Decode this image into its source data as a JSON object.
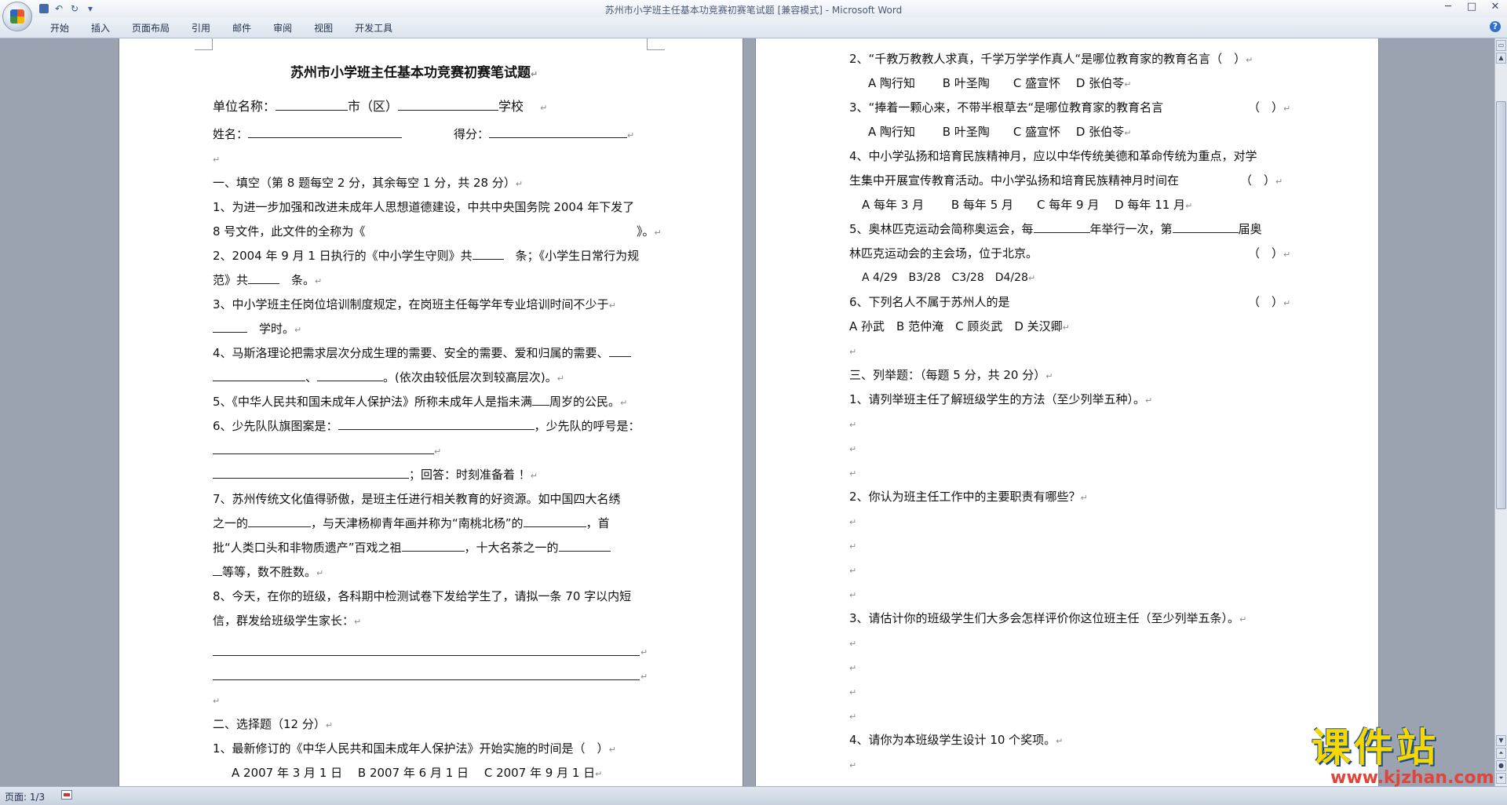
{
  "window": {
    "title": "苏州市小学班主任基本功竞赛初赛笔试题 [兼容模式] - Microsoft Word",
    "controls": [
      "─",
      "□",
      "✕"
    ]
  },
  "quick_access": {
    "undo": "↶",
    "redo": "↻",
    "more": "▾"
  },
  "ribbon": {
    "tabs": [
      "开始",
      "插入",
      "页面布局",
      "引用",
      "邮件",
      "审阅",
      "视图",
      "开发工具"
    ],
    "help": "?"
  },
  "status": {
    "page": "页面: 1/3"
  },
  "watermark": {
    "title": "课件站",
    "url": "www.kjzhan.com"
  },
  "left_page": {
    "title": "苏州市小学班主任基本功竞赛初赛笔试题",
    "unit_label": "单位名称：",
    "unit_city": "市（区）",
    "unit_school": "学校",
    "name_label": "姓名：",
    "score_label": "得分：",
    "sec1": "一、填空（第 8 题每空 2 分，其余每空 1 分，共 28 分）",
    "q1a": "1、为进一步加强和改进未成年人思想道德建设，中共中央国务院 2004 年下发了",
    "q1b": "8 号文件，此文件的全称为《",
    "q1c": "》。",
    "q2a": "2、2004 年 9 月 1 日执行的《中小学生守则》共",
    "q2b": "条；《小学生日常行为规",
    "q2c": "范》共",
    "q2d": "条。",
    "q3a": "3、中小学班主任岗位培训制度规定，在岗班主任每学年专业培训时间不少于",
    "q3b": "学时。",
    "q4a": "4、马斯洛理论把需求层次分成生理的需要、安全的需要、爱和归属的需要、",
    "q4b": "、",
    "q4c": "。(依次由较低层次到较高层次)。",
    "q5a": "5、《中华人民共和国未成年人保护法》所称未成年人是指未满",
    "q5b": "周岁的公民。",
    "q6a": "6、少先队队旗图案是：",
    "q6b": "，少先队的呼号是：",
    "q6c": "；回答：时刻准备着 ！",
    "q7a": "7、苏州传统文化值得骄傲，是班主任进行相关教育的好资源。如中国四大名绣",
    "q7b1": "之一的",
    "q7b2": "，与天津杨柳青年画并称为“南桃北杨”的",
    "q7b3": "，首",
    "q7c1": "批“人类口头和非物质遗产”百戏之祖",
    "q7c2": "，十大名茶之一的",
    "q7d": "等等，数不胜数。",
    "q8a": "8、今天，在你的班级，各科期中检测试卷下发给学生了，请拟一条 70 字以内短",
    "q8b": "信，群发给班级学生家长：",
    "sec2": "二、选择题（12 分）",
    "c1": "1、最新修订的《中华人民共和国未成年人保护法》开始实施的时间是（　）",
    "c1o": "A 2007 年 3 月 1 日　 B 2007 年 6 月 1 日　 C 2007 年 9 月 1 日"
  },
  "right_page": {
    "c2": "2、“千教万教教人求真，千学万学学作真人“是哪位教育家的教育名言（　）",
    "c2o": "A 陶行知　　 B 叶圣陶　　C 盛宣怀　 D 张伯苓",
    "c3": "3、“捧着一颗心来，不带半根草去“是哪位教育家的教育名言",
    "c3p": "（　）",
    "c3o": "A 陶行知　　 B 叶圣陶　　C 盛宣怀　 D 张伯苓",
    "c4a": "4、中小学弘扬和培育民族精神月，应以中华传统美德和革命传统为重点，对学",
    "c4b": "生集中开展宣传教育活动。中小学弘扬和培育民族精神月时间在",
    "c4p": "（　）",
    "c4o": "A 每年 3 月　　 B 每年 5 月　　C 每年 9 月　 D 每年 11 月",
    "c5a1": "5、奥林匹克运动会简称奥运会，每",
    "c5a2": "年举行一次，第",
    "c5a3": "届奥",
    "c5b": "林匹克运动会的主会场，位于北京。",
    "c5p": "（　）",
    "c5o": "A 4/29　B3/28　C3/28　D4/28",
    "c6": "6、下列名人不属于苏州人的是",
    "c6p": "（　）",
    "c6o": "A 孙武　B 范仲淹　C 顾炎武　D 关汉卿",
    "sec3": "三、列举题：（每题 5 分，共 20 分）",
    "l1": "1、请列举班主任了解班级学生的方法（至少列举五种）。",
    "l2": "2、你认为班主任工作中的主要职责有哪些？",
    "l3": "3、请估计你的班级学生们大多会怎样评价你这位班主任（至少列举五条）。",
    "l4": "4、请你为本班级学生设计 10 个奖项。"
  },
  "marks": {
    "para": "↵"
  }
}
